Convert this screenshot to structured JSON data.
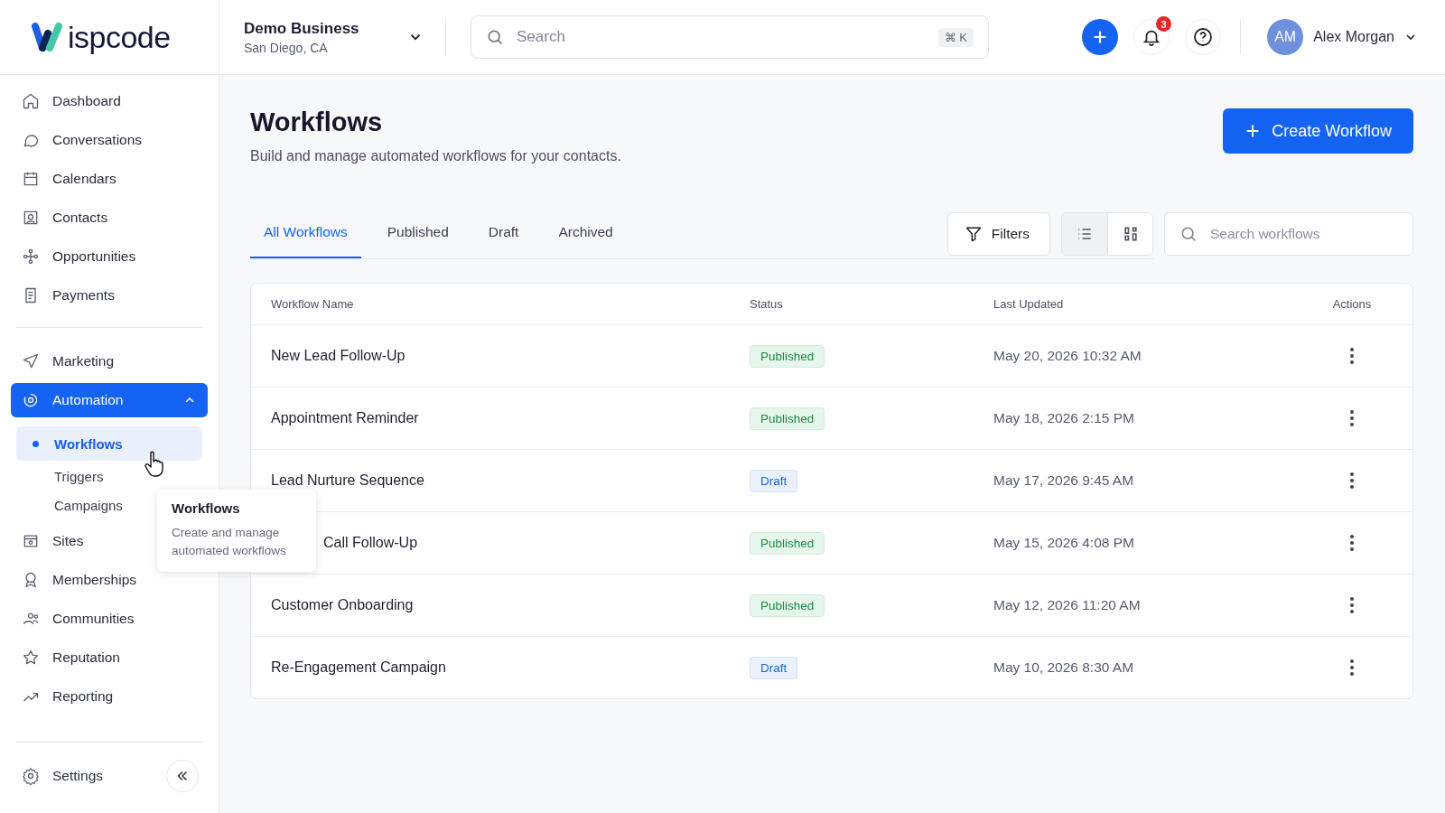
{
  "logo": {
    "text": "ispcode"
  },
  "business": {
    "name": "Demo Business",
    "location": "San Diego, CA"
  },
  "search": {
    "placeholder": "Search",
    "shortcut": "⌘ K"
  },
  "notifications": {
    "count": "3"
  },
  "user": {
    "initials": "AM",
    "name": "Alex Morgan"
  },
  "sidebar": {
    "items": [
      {
        "label": "Dashboard",
        "selected": false
      },
      {
        "label": "Conversations",
        "selected": false
      },
      {
        "label": "Calendars",
        "selected": false
      },
      {
        "label": "Contacts",
        "selected": false
      },
      {
        "label": "Opportunities",
        "selected": false
      },
      {
        "label": "Payments",
        "selected": false
      }
    ],
    "items_2": [
      {
        "label": "Marketing",
        "selected": false
      },
      {
        "label": "Automation",
        "selected": true,
        "expanded": true,
        "children": [
          {
            "label": "Workflows",
            "selected": true
          },
          {
            "label": "Triggers",
            "selected": false
          },
          {
            "label": "Campaigns",
            "selected": false
          }
        ]
      },
      {
        "label": "Sites",
        "selected": false
      },
      {
        "label": "Memberships",
        "selected": false
      },
      {
        "label": "Communities",
        "selected": false
      },
      {
        "label": "Reputation",
        "selected": false
      },
      {
        "label": "Reporting",
        "selected": false
      }
    ],
    "settings": "Settings"
  },
  "tooltip": {
    "title": "Workflows",
    "text": "Create and manage automated workflows"
  },
  "page": {
    "title": "Workflows",
    "subtitle": "Build and manage automated workflows for your contacts.",
    "create_button": "Create Workflow"
  },
  "tabs": [
    {
      "label": "All Workflows",
      "selected": true
    },
    {
      "label": "Published",
      "selected": false
    },
    {
      "label": "Draft",
      "selected": false
    },
    {
      "label": "Archived",
      "selected": false
    }
  ],
  "filters_button": "Filters",
  "view_toggle": [
    {
      "selected": true
    },
    {
      "selected": false
    }
  ],
  "workflow_search": {
    "placeholder": "Search workflows"
  },
  "table": {
    "columns": [
      "Workflow Name",
      "Status",
      "Last Updated",
      "Actions"
    ],
    "rows": [
      {
        "name": "New Lead Follow-Up",
        "status": "Published",
        "kind": "published",
        "updated": "May 20, 2026 10:32 AM"
      },
      {
        "name": "Appointment Reminder",
        "status": "Published",
        "kind": "published",
        "updated": "May 18, 2026 2:15 PM"
      },
      {
        "name": "Lead Nurture Sequence",
        "status": "Draft",
        "kind": "draft",
        "updated": "May 17, 2026 9:45 AM"
      },
      {
        "name": "Call Follow-Up",
        "covered": true,
        "status": "Published",
        "kind": "published",
        "updated": "May 15, 2026 4:08 PM"
      },
      {
        "name": "Customer Onboarding",
        "status": "Published",
        "kind": "published",
        "updated": "May 12, 2026 11:20 AM"
      },
      {
        "name": "Re-Engagement Campaign",
        "status": "Draft",
        "kind": "draft",
        "updated": "May 10, 2026 8:30 AM"
      }
    ]
  }
}
